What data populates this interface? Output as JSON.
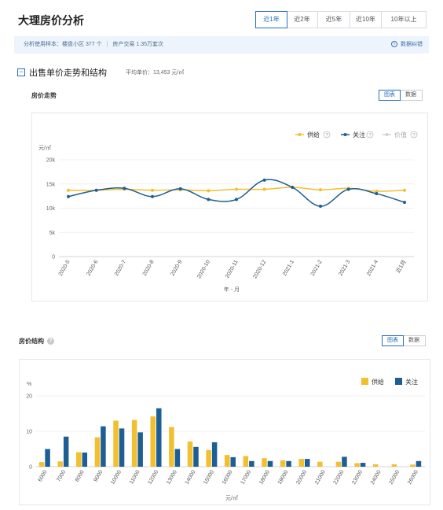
{
  "page": {
    "title": "大理房价分析",
    "tabs": [
      "近1年",
      "近2年",
      "近5年",
      "近10年",
      "10年以上"
    ],
    "info": {
      "sample": "分析使用样本：楼盘小区 377 个",
      "trade": "房产交易 1.35万套次",
      "feedback": "数据纠错"
    }
  },
  "section": {
    "title": "出售单价走势和结构",
    "avg": "平均单价：13,453 元/㎡"
  },
  "trend": {
    "title": "房价走势",
    "toggle": {
      "chart": "图表",
      "data": "数据"
    },
    "legend": {
      "supply": "供给",
      "attention": "关注",
      "price": "价值"
    },
    "colors": {
      "supply": "#f2bf2f",
      "attention": "#1d5e94",
      "price": "#d0d0d0"
    }
  },
  "structure": {
    "title": "房价结构",
    "toggle": {
      "chart": "图表",
      "data": "数据"
    },
    "legend": {
      "supply": "供给",
      "attention": "关注"
    },
    "colors": {
      "supply": "#f2bf2f",
      "attention": "#1d5e94"
    }
  },
  "chart_data": [
    {
      "type": "line",
      "ylabel": "元/㎡",
      "xlabel": "年 - 月",
      "x": [
        "2020-5",
        "2020-6",
        "2020-7",
        "2020-8",
        "2020-9",
        "2020-10",
        "2020-11",
        "2020-12",
        "2021-1",
        "2021-2",
        "2021-3",
        "2021-4",
        "近1月"
      ],
      "yticks": [
        "0",
        "5k",
        "10k",
        "15k",
        "20k"
      ],
      "ylim": [
        0,
        20000
      ],
      "series": [
        {
          "name": "供给",
          "values": [
            13700,
            13700,
            13900,
            13700,
            13800,
            13600,
            13900,
            13900,
            14300,
            13800,
            14100,
            13500,
            13700
          ]
        },
        {
          "name": "关注",
          "values": [
            12400,
            13700,
            14100,
            12400,
            14000,
            11800,
            11800,
            15800,
            14300,
            10400,
            13900,
            13000,
            11200
          ]
        },
        {
          "name": "价值",
          "values": []
        }
      ],
      "grid": true,
      "legend": "top-right"
    },
    {
      "type": "bar",
      "ylabel": "%",
      "xlabel": "元/㎡",
      "categories": [
        "6000",
        "7000",
        "8000",
        "9000",
        "10000",
        "11000",
        "12000",
        "13000",
        "14000",
        "15000",
        "16000",
        "17000",
        "18000",
        "19000",
        "20000",
        "21000",
        "22000",
        "23000",
        "24000",
        "25000",
        "26000"
      ],
      "yticks": [
        "0",
        "10",
        "20"
      ],
      "ylim": [
        0,
        20
      ],
      "series": [
        {
          "name": "供给",
          "values": [
            1.3,
            1.5,
            4.1,
            8.3,
            13.0,
            13.2,
            14.2,
            11.2,
            7.1,
            4.7,
            3.3,
            3.0,
            2.4,
            1.8,
            2.2,
            1.4,
            1.4,
            1.0,
            0.7,
            0.7,
            0.6
          ]
        },
        {
          "name": "关注",
          "values": [
            5.0,
            8.5,
            4.0,
            11.4,
            10.8,
            9.7,
            16.5,
            5.0,
            5.6,
            6.9,
            2.7,
            1.6,
            1.6,
            1.6,
            2.2,
            0,
            2.8,
            1.1,
            0,
            0,
            1.6
          ]
        }
      ],
      "grid": true,
      "legend": "top-right"
    }
  ]
}
